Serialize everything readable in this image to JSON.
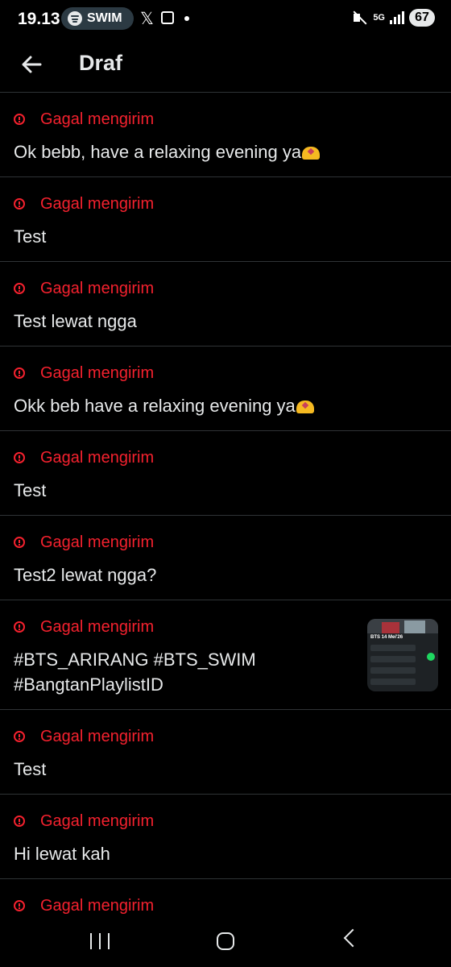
{
  "status_bar": {
    "time": "19.13",
    "spotify_label": "SWIM",
    "x_glyph": "𝕏",
    "network": "5G",
    "battery": "67",
    "icons": [
      "spotify-icon",
      "x-icon",
      "screen-record-icon",
      "notification-dot-icon",
      "mute-icon",
      "network-icon",
      "signal-icon",
      "battery-icon"
    ]
  },
  "header": {
    "title": "Draf",
    "back_icon": "arrow-left-icon"
  },
  "colors": {
    "background": "#000000",
    "text": "#e7e9ea",
    "error": "#f4212e",
    "divider": "#2f3336"
  },
  "drafts": [
    {
      "status": "Gagal mengirim",
      "text": "Ok bebb, have a relaxing evening ya",
      "emoji": "heart-hands"
    },
    {
      "status": "Gagal mengirim",
      "text": "Test"
    },
    {
      "status": "Gagal mengirim",
      "text": "Test lewat ngga"
    },
    {
      "status": "Gagal mengirim",
      "text": "Okk beb have a relaxing evening ya",
      "emoji": "heart-hands"
    },
    {
      "status": "Gagal mengirim",
      "text": "Test"
    },
    {
      "status": "Gagal mengirim",
      "text": "Test2 lewat ngga?"
    },
    {
      "status": "Gagal mengirim",
      "text": "#BTS_ARIRANG #BTS_SWIM\n#BangtanPlaylistID",
      "thumbnail": {
        "title": "BTS 14 Mei'26"
      }
    },
    {
      "status": "Gagal mengirim",
      "text": "Test"
    },
    {
      "status": "Gagal mengirim",
      "text": "Hi lewat kah"
    },
    {
      "status": "Gagal mengirim",
      "text": ""
    }
  ],
  "nav_bar": {
    "icons": [
      "recent-apps-icon",
      "home-icon",
      "back-icon"
    ]
  }
}
